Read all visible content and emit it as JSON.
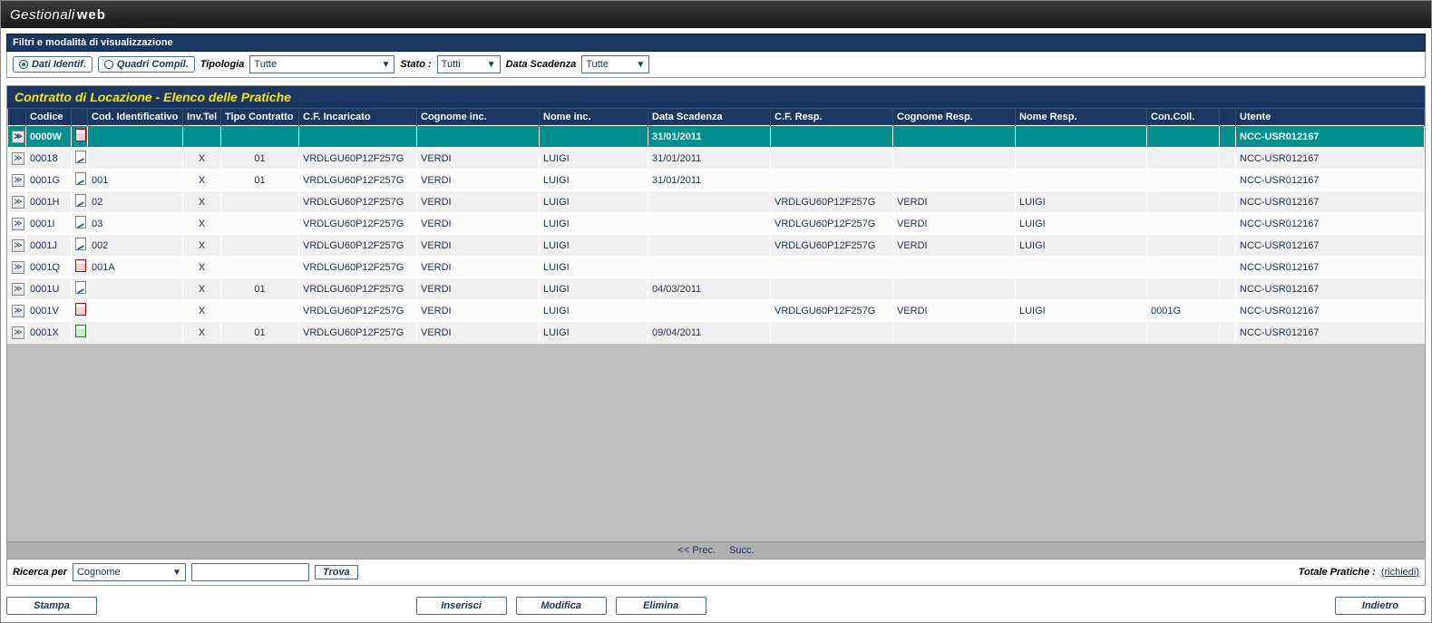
{
  "app": {
    "name1": "Gestionali",
    "name2": "web"
  },
  "filters": {
    "section_title": "Filtri e modalità di visualizzazione",
    "radio1": "Dati Identif.",
    "radio2": "Quadri Compil.",
    "tipologia_label": "Tipologia",
    "tipologia_value": "Tutte",
    "stato_label": "Stato :",
    "stato_value": "Tutti",
    "scadenza_label": "Data Scadenza",
    "scadenza_value": "Tutte"
  },
  "grid": {
    "title": "Contratto di Locazione - Elenco delle Pratiche",
    "columns": [
      "",
      "Codice",
      "",
      "Cod. Identificativo",
      "Inv.Tel",
      "Tipo Contratto",
      "C.F. Incaricato",
      "Cognome inc.",
      "Nome inc.",
      "Data Scadenza",
      "C.F. Resp.",
      "Cognome Resp.",
      "Nome Resp.",
      "Con.Coll.",
      "",
      "Utente"
    ],
    "rows": [
      {
        "sel": true,
        "status": "red",
        "codice": "0000W",
        "cod_id": "",
        "inv": "",
        "tipo": "",
        "cf_inc": "",
        "cog_inc": "",
        "nome_inc": "",
        "scad": "31/01/2011",
        "cf_resp": "",
        "cog_resp": "",
        "nome_resp": "",
        "coll": "",
        "utente": "NCC-USR012167"
      },
      {
        "status": "edit",
        "codice": "00018",
        "cod_id": "",
        "inv": "X",
        "tipo": "01",
        "cf_inc": "VRDLGU60P12F257G",
        "cog_inc": "VERDI",
        "nome_inc": "LUIGI",
        "scad": "31/01/2011",
        "cf_resp": "",
        "cog_resp": "",
        "nome_resp": "",
        "coll": "",
        "utente": "NCC-USR012167"
      },
      {
        "status": "edit",
        "codice": "0001G",
        "cod_id": "001",
        "inv": "X",
        "tipo": "01",
        "cf_inc": "VRDLGU60P12F257G",
        "cog_inc": "VERDI",
        "nome_inc": "LUIGI",
        "scad": "31/01/2011",
        "cf_resp": "",
        "cog_resp": "",
        "nome_resp": "",
        "coll": "",
        "utente": "NCC-USR012167"
      },
      {
        "status": "edit",
        "codice": "0001H",
        "cod_id": "02",
        "inv": "X",
        "tipo": "",
        "cf_inc": "VRDLGU60P12F257G",
        "cog_inc": "VERDI",
        "nome_inc": "LUIGI",
        "scad": "",
        "cf_resp": "VRDLGU60P12F257G",
        "cog_resp": "VERDI",
        "nome_resp": "LUIGI",
        "coll": "",
        "utente": "NCC-USR012167"
      },
      {
        "status": "edit",
        "codice": "0001I",
        "cod_id": "03",
        "inv": "X",
        "tipo": "",
        "cf_inc": "VRDLGU60P12F257G",
        "cog_inc": "VERDI",
        "nome_inc": "LUIGI",
        "scad": "",
        "cf_resp": "VRDLGU60P12F257G",
        "cog_resp": "VERDI",
        "nome_resp": "LUIGI",
        "coll": "",
        "utente": "NCC-USR012167"
      },
      {
        "status": "edit",
        "codice": "0001J",
        "cod_id": "002",
        "inv": "X",
        "tipo": "",
        "cf_inc": "VRDLGU60P12F257G",
        "cog_inc": "VERDI",
        "nome_inc": "LUIGI",
        "scad": "",
        "cf_resp": "VRDLGU60P12F257G",
        "cog_resp": "VERDI",
        "nome_resp": "LUIGI",
        "coll": "",
        "utente": "NCC-USR012167"
      },
      {
        "status": "red",
        "codice": "0001Q",
        "cod_id": "001A",
        "inv": "X",
        "tipo": "",
        "cf_inc": "VRDLGU60P12F257G",
        "cog_inc": "VERDI",
        "nome_inc": "LUIGI",
        "scad": "",
        "cf_resp": "",
        "cog_resp": "",
        "nome_resp": "",
        "coll": "",
        "utente": "NCC-USR012167"
      },
      {
        "status": "edit",
        "codice": "0001U",
        "cod_id": "",
        "inv": "X",
        "tipo": "01",
        "cf_inc": "VRDLGU60P12F257G",
        "cog_inc": "VERDI",
        "nome_inc": "LUIGI",
        "scad": "04/03/2011",
        "cf_resp": "",
        "cog_resp": "",
        "nome_resp": "",
        "coll": "",
        "utente": "NCC-USR012167"
      },
      {
        "status": "red",
        "codice": "0001V",
        "cod_id": "",
        "inv": "X",
        "tipo": "",
        "cf_inc": "VRDLGU60P12F257G",
        "cog_inc": "VERDI",
        "nome_inc": "LUIGI",
        "scad": "",
        "cf_resp": "VRDLGU60P12F257G",
        "cog_resp": "VERDI",
        "nome_resp": "LUIGI",
        "coll": "0001G",
        "utente": "NCC-USR012167"
      },
      {
        "status": "green",
        "codice": "0001X",
        "cod_id": "",
        "inv": "X",
        "tipo": "01",
        "cf_inc": "VRDLGU60P12F257G",
        "cog_inc": "VERDI",
        "nome_inc": "LUIGI",
        "scad": "09/04/2011",
        "cf_resp": "",
        "cog_resp": "",
        "nome_resp": "",
        "coll": "",
        "utente": "NCC-USR012167"
      }
    ]
  },
  "pager": {
    "prev": "<<   Prec.",
    "next": "Succ."
  },
  "search": {
    "label": "Ricerca per",
    "field_value": "Cognome",
    "input_value": "",
    "find_button": "Trova",
    "totale_label": "Totale Pratiche :",
    "totale_link": "(richiedi)"
  },
  "footer": {
    "stampa": "Stampa",
    "inserisci": "Inserisci",
    "modifica": "Modifica",
    "elimina": "Elimina",
    "indietro": "Indietro"
  }
}
